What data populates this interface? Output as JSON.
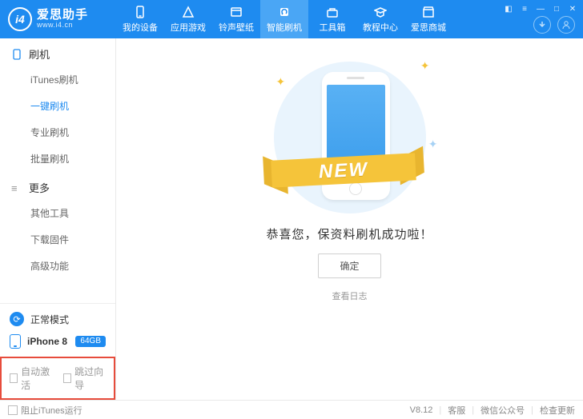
{
  "app": {
    "logo_letters": "i4",
    "title": "爱思助手",
    "subtitle": "www.i4.cn"
  },
  "nav": [
    {
      "label": "我的设备"
    },
    {
      "label": "应用游戏"
    },
    {
      "label": "铃声壁纸"
    },
    {
      "label": "智能刷机",
      "active": true
    },
    {
      "label": "工具箱"
    },
    {
      "label": "教程中心"
    },
    {
      "label": "爱思商城"
    }
  ],
  "sidebar": {
    "group1": {
      "title": "刷机",
      "items": [
        {
          "label": "iTunes刷机"
        },
        {
          "label": "一键刷机",
          "active": true
        },
        {
          "label": "专业刷机"
        },
        {
          "label": "批量刷机"
        }
      ]
    },
    "group2": {
      "title": "更多",
      "items": [
        {
          "label": "其他工具"
        },
        {
          "label": "下载固件"
        },
        {
          "label": "高级功能"
        }
      ]
    },
    "mode": "正常模式",
    "device": {
      "name": "iPhone 8",
      "storage": "64GB"
    },
    "checks": {
      "auto_activate": "自动激活",
      "skip_wizard": "跳过向导"
    }
  },
  "main": {
    "ribbon": "NEW",
    "message": "恭喜您，保资料刷机成功啦！",
    "ok": "确定",
    "view_log": "查看日志"
  },
  "footer": {
    "block_itunes": "阻止iTunes运行",
    "version": "V8.12",
    "support": "客服",
    "wechat": "微信公众号",
    "update": "检查更新"
  }
}
